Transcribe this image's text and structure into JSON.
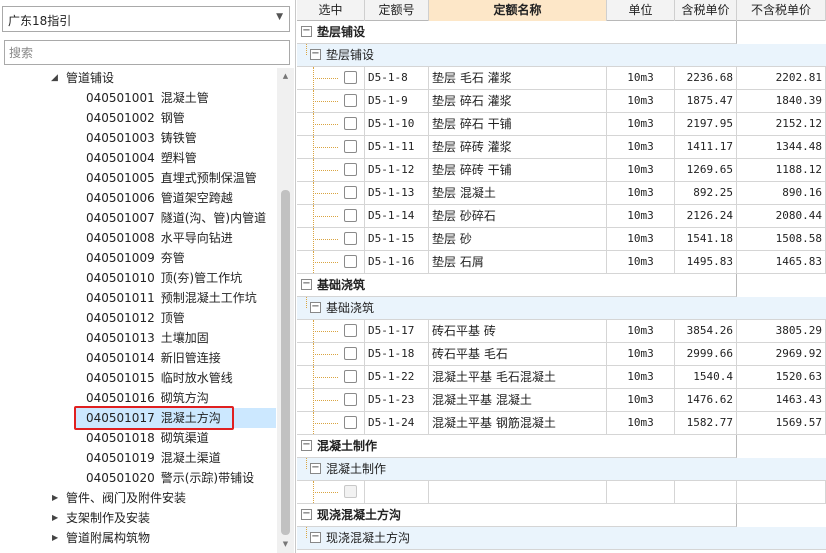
{
  "region": {
    "selected": "广东18指引"
  },
  "search": {
    "placeholder": "搜索"
  },
  "tree": {
    "parent": "管道铺设",
    "items": [
      {
        "code": "040501001",
        "name": "混凝土管"
      },
      {
        "code": "040501002",
        "name": "钢管"
      },
      {
        "code": "040501003",
        "name": "铸铁管"
      },
      {
        "code": "040501004",
        "name": "塑料管"
      },
      {
        "code": "040501005",
        "name": "直埋式预制保温管"
      },
      {
        "code": "040501006",
        "name": "管道架空跨越"
      },
      {
        "code": "040501007",
        "name": "隧道(沟、管)内管道"
      },
      {
        "code": "040501008",
        "name": "水平导向钻进"
      },
      {
        "code": "040501009",
        "name": "夯管"
      },
      {
        "code": "040501010",
        "name": "顶(夯)管工作坑"
      },
      {
        "code": "040501011",
        "name": "预制混凝土工作坑"
      },
      {
        "code": "040501012",
        "name": "顶管"
      },
      {
        "code": "040501013",
        "name": "土壤加固"
      },
      {
        "code": "040501014",
        "name": "新旧管连接"
      },
      {
        "code": "040501015",
        "name": "临时放水管线"
      },
      {
        "code": "040501016",
        "name": "砌筑方沟"
      },
      {
        "code": "040501017",
        "name": "混凝土方沟"
      },
      {
        "code": "040501018",
        "name": "砌筑渠道"
      },
      {
        "code": "040501019",
        "name": "混凝土渠道"
      },
      {
        "code": "040501020",
        "name": "警示(示踪)带铺设"
      }
    ],
    "siblings": [
      "管件、阀门及附件安装",
      "支架制作及安装",
      "管道附属构筑物"
    ]
  },
  "table": {
    "headers": [
      "选中",
      "定额号",
      "定额名称",
      "单位",
      "含税单价",
      "不含税单价"
    ],
    "groups": [
      {
        "title": "垫层铺设",
        "subtitle": "垫层铺设",
        "rows": [
          {
            "code": "D5-1-8",
            "name": "垫层 毛石 灌浆",
            "unit": "10m3",
            "tax": "2236.68",
            "notax": "2202.81"
          },
          {
            "code": "D5-1-9",
            "name": "垫层 碎石 灌浆",
            "unit": "10m3",
            "tax": "1875.47",
            "notax": "1840.39"
          },
          {
            "code": "D5-1-10",
            "name": "垫层 碎石 干铺",
            "unit": "10m3",
            "tax": "2197.95",
            "notax": "2152.12"
          },
          {
            "code": "D5-1-11",
            "name": "垫层 碎砖 灌浆",
            "unit": "10m3",
            "tax": "1411.17",
            "notax": "1344.48"
          },
          {
            "code": "D5-1-12",
            "name": "垫层 碎砖 干铺",
            "unit": "10m3",
            "tax": "1269.65",
            "notax": "1188.12"
          },
          {
            "code": "D5-1-13",
            "name": "垫层 混凝土",
            "unit": "10m3",
            "tax": "892.25",
            "notax": "890.16"
          },
          {
            "code": "D5-1-14",
            "name": "垫层 砂碎石",
            "unit": "10m3",
            "tax": "2126.24",
            "notax": "2080.44"
          },
          {
            "code": "D5-1-15",
            "name": "垫层 砂",
            "unit": "10m3",
            "tax": "1541.18",
            "notax": "1508.58"
          },
          {
            "code": "D5-1-16",
            "name": "垫层 石屑",
            "unit": "10m3",
            "tax": "1495.83",
            "notax": "1465.83"
          }
        ]
      },
      {
        "title": "基础浇筑",
        "subtitle": "基础浇筑",
        "rows": [
          {
            "code": "D5-1-17",
            "name": "砖石平基 砖",
            "unit": "10m3",
            "tax": "3854.26",
            "notax": "3805.29"
          },
          {
            "code": "D5-1-18",
            "name": "砖石平基 毛石",
            "unit": "10m3",
            "tax": "2999.66",
            "notax": "2969.92"
          },
          {
            "code": "D5-1-22",
            "name": "混凝土平基 毛石混凝土",
            "unit": "10m3",
            "tax": "1540.4",
            "notax": "1520.63"
          },
          {
            "code": "D5-1-23",
            "name": "混凝土平基 混凝土",
            "unit": "10m3",
            "tax": "1476.62",
            "notax": "1463.43"
          },
          {
            "code": "D5-1-24",
            "name": "混凝土平基 钢筋混凝土",
            "unit": "10m3",
            "tax": "1582.77",
            "notax": "1569.57"
          }
        ]
      },
      {
        "title": "混凝土制作",
        "subtitle": "混凝土制作",
        "rows": [
          {
            "code": "",
            "name": "",
            "unit": "",
            "tax": "",
            "notax": "",
            "disabled": true
          }
        ]
      },
      {
        "title": "现浇混凝土方沟",
        "subtitle": "现浇混凝土方沟",
        "rows": []
      }
    ]
  }
}
